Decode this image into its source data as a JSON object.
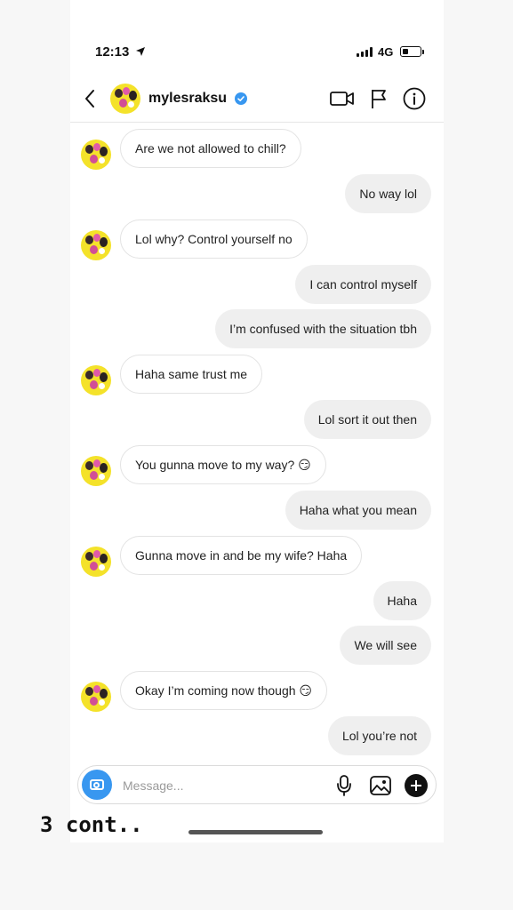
{
  "status_bar": {
    "time": "12:13",
    "network": "4G",
    "battery_level": 0.35,
    "signal_bars": 4
  },
  "header": {
    "username": "mylesraksu",
    "verified": true,
    "icons": [
      "chevron-left-icon",
      "video-camera-icon",
      "flag-icon",
      "info-icon"
    ]
  },
  "messages": [
    {
      "sender": "them",
      "text": "Are we not allowed to chill?"
    },
    {
      "sender": "me",
      "text": "No way lol"
    },
    {
      "sender": "them",
      "text": "Lol why? Control yourself no"
    },
    {
      "sender": "me",
      "text": "I can control myself"
    },
    {
      "sender": "me",
      "text": "I’m confused with the situation tbh"
    },
    {
      "sender": "them",
      "text": "Haha same trust me"
    },
    {
      "sender": "me",
      "text": "Lol sort it out then"
    },
    {
      "sender": "them",
      "text": "You gunna move to my way? 😏"
    },
    {
      "sender": "me",
      "text": "Haha what you mean"
    },
    {
      "sender": "them",
      "text": "Gunna move in and be my wife? Haha"
    },
    {
      "sender": "me",
      "text": "Haha"
    },
    {
      "sender": "me",
      "text": "We will see"
    },
    {
      "sender": "them",
      "text": "Okay I’m coming now though 😏"
    },
    {
      "sender": "me",
      "text": "Lol you’re not"
    }
  ],
  "composer": {
    "placeholder": "Message...",
    "icons": [
      "camera-icon",
      "microphone-icon",
      "gallery-icon",
      "plus-icon"
    ]
  },
  "caption": "3 cont..",
  "colors": {
    "accent_blue": "#3897f0",
    "incoming_bubble": "#ffffff",
    "outgoing_bubble": "#efefef",
    "avatar_bg": "#f4e22a"
  }
}
